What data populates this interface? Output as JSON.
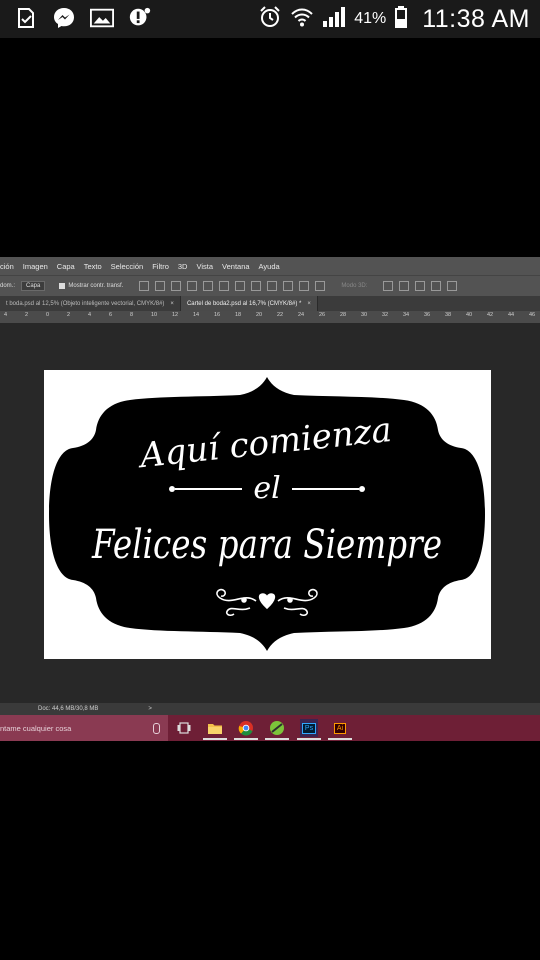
{
  "status_bar": {
    "icons": [
      "download-done-icon",
      "messenger-icon",
      "gallery-icon",
      "alert-bubble-icon"
    ],
    "right_icons": [
      "alarm-icon",
      "wifi-icon",
      "signal-icon",
      "battery-icon"
    ],
    "battery": "41%",
    "time": "11:38 AM"
  },
  "photoshop": {
    "menu": [
      "ción",
      "Imagen",
      "Capa",
      "Texto",
      "Selección",
      "Filtro",
      "3D",
      "Vista",
      "Ventana",
      "Ayuda"
    ],
    "options": {
      "tool_prefix": "dom.:",
      "select_value": "Capa",
      "checkbox_label": "Mostrar contr. transf.",
      "mode_3d": "Modo 3D:"
    },
    "tabs": [
      {
        "label": "t boda.psd al 12,5% (Objeto inteligente vectorial, CMYK/8#)",
        "close": "×",
        "active": false
      },
      {
        "label": "Cartel de boda2.psd al 16,7% (CMYK/8#) *",
        "close": "×",
        "active": true
      }
    ],
    "ruler_ticks": [
      "4",
      "2",
      "0",
      "2",
      "4",
      "6",
      "8",
      "10",
      "12",
      "14",
      "16",
      "18",
      "20",
      "22",
      "24",
      "26",
      "28",
      "30",
      "32",
      "34",
      "36",
      "38",
      "40",
      "42",
      "44",
      "46"
    ],
    "status": {
      "doc": "Doc: 44,6 MB/30,8 MB",
      "arrow": ">"
    }
  },
  "artwork": {
    "line1": "Aquí comienza",
    "line2": "el",
    "line3": "Felices para Siempre"
  },
  "taskbar": {
    "search_placeholder": "ntame cualquier cosa",
    "apps": [
      "task-view-icon",
      "file-explorer-icon",
      "chrome-icon",
      "app-green-icon",
      "photoshop-icon",
      "illustrator-icon"
    ],
    "ps_label": "Ps",
    "ai_label": "Ai"
  },
  "colors": {
    "taskbar": "#6e1f36",
    "ps_bg": "#282828",
    "ps_panel": "#535353"
  }
}
